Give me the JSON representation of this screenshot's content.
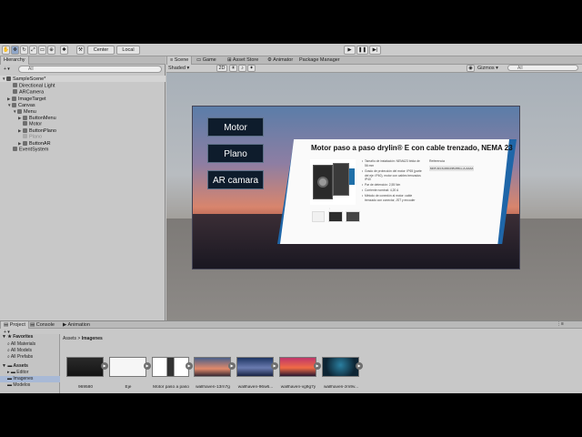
{
  "toolbar": {
    "pivot_label": "Center",
    "space_label": "Local"
  },
  "hierarchy": {
    "tab_label": "Hierarchy",
    "search_placeholder": "All",
    "items": [
      {
        "label": "SampleScene*"
      },
      {
        "label": "Directional Light"
      },
      {
        "label": "ARCamera"
      },
      {
        "label": "ImageTarget"
      },
      {
        "label": "Canvas"
      },
      {
        "label": "Menu"
      },
      {
        "label": "ButtonMenu"
      },
      {
        "label": "Motor"
      },
      {
        "label": "ButtonPlano"
      },
      {
        "label": "Plano"
      },
      {
        "label": "ButtonAR"
      },
      {
        "label": "EventSystem"
      }
    ]
  },
  "scene": {
    "tabs": [
      {
        "label": "Scene"
      },
      {
        "label": "Game"
      },
      {
        "label": "Asset Store"
      },
      {
        "label": "Animator"
      },
      {
        "label": "Package Manager"
      }
    ],
    "shading_mode": "Shaded",
    "mode_2d": "2D",
    "gizmos_label": "Gizmos",
    "search_placeholder": "All"
  },
  "canvas_ui": {
    "buttons": [
      {
        "label": "Motor"
      },
      {
        "label": "Plano"
      },
      {
        "label": "AR camara"
      }
    ],
    "card_title": "Motor paso a paso drylin® E con cable trenzado, NEMA 23",
    "specs": [
      "Tamaño de instalación: NEMA23 brida de 56 mm",
      "Grado de protección del motor: IP65 (parte del eje: IP40), motor con cables trenzados IP40",
      "Par de detención: 2,55 Nm",
      "Corriente nominal: 4,20 A",
      "Método de conexión al motor: cable trenzado con conector, JST y encoder"
    ],
    "reference_label": "Referencia",
    "reference_value": "MOT-AN-S-060-035-056-L-A-AAAA"
  },
  "bottom": {
    "tabs": [
      {
        "label": "Project"
      },
      {
        "label": "Console"
      },
      {
        "label": "Animation"
      }
    ],
    "sidebar": [
      {
        "label": "Favorites"
      },
      {
        "label": "All Materials"
      },
      {
        "label": "All Models"
      },
      {
        "label": "All Prefabs"
      },
      {
        "label": "Assets"
      },
      {
        "label": "Editor"
      },
      {
        "label": "Imagenes"
      },
      {
        "label": "Modelos"
      }
    ],
    "breadcrumb": [
      "Assets",
      "Imagenes"
    ],
    "assets": [
      {
        "label": "969580"
      },
      {
        "label": "Eje"
      },
      {
        "label": "Motor paso a paso"
      },
      {
        "label": "wallhaven-13rn7g"
      },
      {
        "label": "wallhaven-96w6..."
      },
      {
        "label": "wallhaven-vg9g7y"
      },
      {
        "label": "wallhaven-zm9v..."
      }
    ]
  }
}
